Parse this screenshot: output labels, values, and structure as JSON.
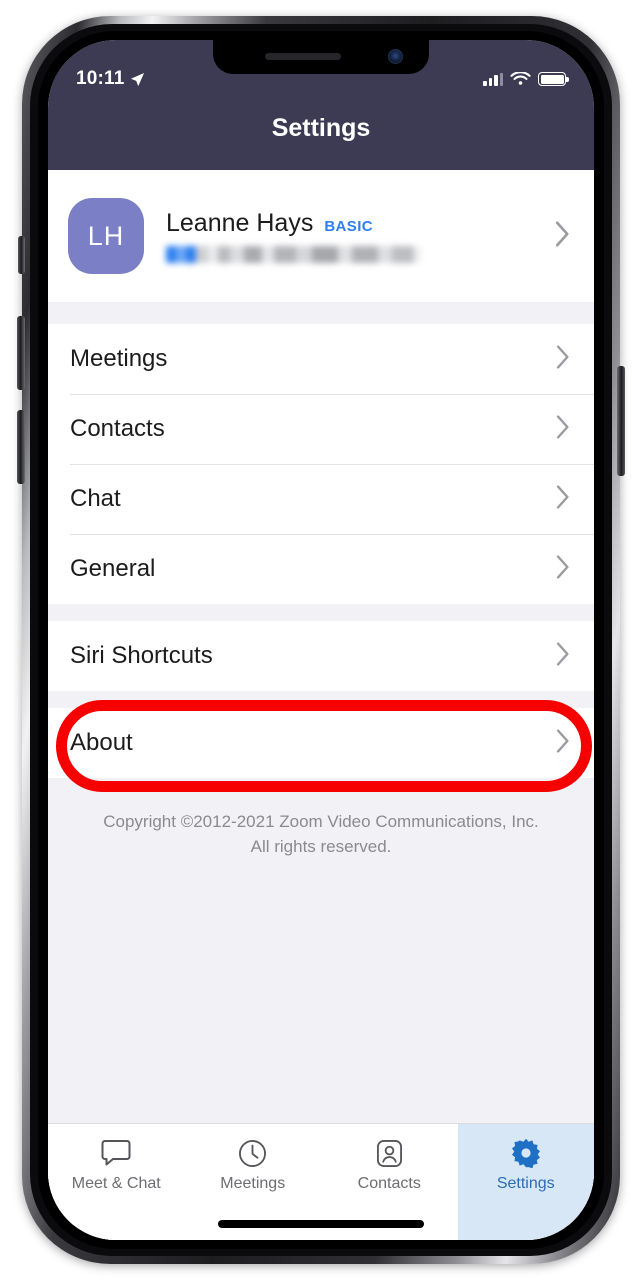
{
  "status_bar": {
    "time": "10:11",
    "location_icon": "location-arrow-icon",
    "signal_icon": "cellular-signal-icon",
    "wifi_icon": "wifi-icon",
    "battery_icon": "battery-full-icon"
  },
  "navbar": {
    "title": "Settings"
  },
  "profile": {
    "initials": "LH",
    "name": "Leanne Hays",
    "plan_badge": "BASIC",
    "email_redacted": true,
    "chevron_icon": "chevron-right-icon"
  },
  "menu": {
    "group_one": [
      {
        "label": "Meetings",
        "chevron_icon": "chevron-right-icon"
      },
      {
        "label": "Contacts",
        "chevron_icon": "chevron-right-icon"
      },
      {
        "label": "Chat",
        "chevron_icon": "chevron-right-icon"
      },
      {
        "label": "General",
        "chevron_icon": "chevron-right-icon"
      }
    ],
    "group_two": [
      {
        "label": "Siri Shortcuts",
        "chevron_icon": "chevron-right-icon"
      }
    ],
    "group_three": [
      {
        "label": "About",
        "chevron_icon": "chevron-right-icon"
      }
    ]
  },
  "footer": {
    "copyright_line_1": "Copyright ©2012-2021 Zoom Video Communications, Inc.",
    "copyright_line_2": "All rights reserved."
  },
  "annotation": {
    "color": "#f60000",
    "target": "General"
  },
  "tabbar": {
    "tabs": [
      {
        "label": "Meet & Chat",
        "icon": "chat-bubble-icon",
        "active": false
      },
      {
        "label": "Meetings",
        "icon": "clock-icon",
        "active": false
      },
      {
        "label": "Contacts",
        "icon": "person-icon",
        "active": false
      },
      {
        "label": "Settings",
        "icon": "gear-icon",
        "active": true
      }
    ]
  },
  "theme": {
    "navbar_bg": "#3d3b54",
    "avatar_bg": "#7b7fc6",
    "accent_blue": "#2d7ff0",
    "active_tab_bg": "#d7e7f6",
    "active_tab_fg": "#2b6cb5"
  }
}
